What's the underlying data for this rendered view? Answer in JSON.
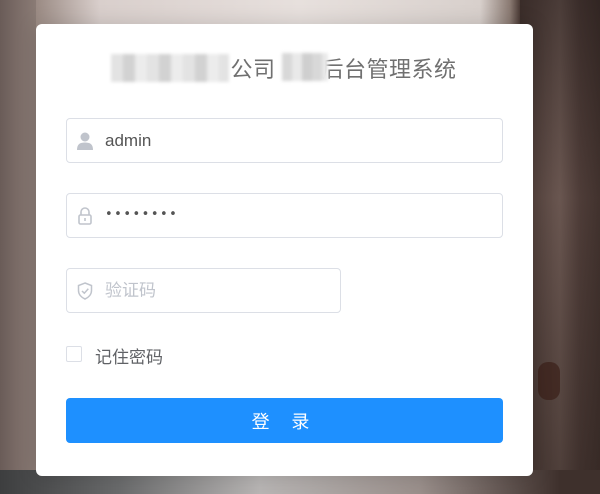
{
  "login": {
    "title_visible": "公司",
    "title_suffix": "后台管理系统",
    "username_value": "admin",
    "password_mask": "••••••••",
    "captcha_placeholder": "验证码",
    "remember_label": "记住密码",
    "login_button": "登 录"
  },
  "colors": {
    "primary": "#1e90ff",
    "border": "#dcdfe6",
    "placeholder": "#c0c4cc",
    "text": "#606266"
  },
  "icons": [
    "user-icon",
    "lock-icon",
    "shield-icon"
  ]
}
